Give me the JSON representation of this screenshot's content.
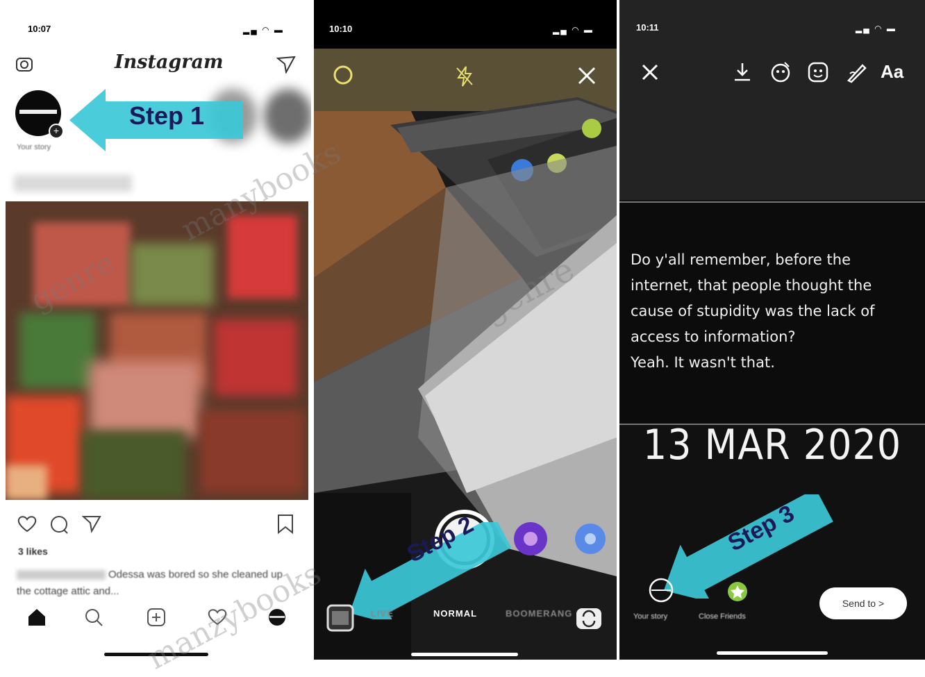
{
  "panel1": {
    "status_time": "10:07",
    "app_title": "Instagram",
    "story_label": "Your story",
    "step_label": "Step 1",
    "likes": "3 likes",
    "caption": "Odessa was bored so she cleaned up the cottage attic and...",
    "icons": [
      "camera-icon",
      "direct-icon",
      "story-plus-icon",
      "heart-icon",
      "comment-icon",
      "share-icon",
      "bookmark-icon",
      "home-icon",
      "search-icon",
      "add-icon",
      "activity-icon",
      "profile-icon"
    ]
  },
  "panel2": {
    "status_time": "10:10",
    "step_label": "Step 2",
    "mode_left": "LIVE",
    "mode_current": "NORMAL",
    "mode_right": "BOOMERANG",
    "icons": [
      "settings-icon",
      "flash-off-icon",
      "close-icon",
      "gallery-icon",
      "flip-camera-icon",
      "shutter-button"
    ]
  },
  "panel3": {
    "status_time": "10:11",
    "text_tool": "Aa",
    "quote": "Do y'all remember, before the internet, that people thought the cause of stupidity was the lack of access to information?\nYeah. It wasn't that.",
    "date_text": "13 MAR 2020",
    "step_label": "Step 3",
    "your_story": "Your story",
    "close_friends": "Close Friends",
    "send_button": "Send to >",
    "icons": [
      "close-icon",
      "download-icon",
      "effects-icon",
      "sticker-icon",
      "draw-icon"
    ]
  },
  "watermark": [
    "genre",
    "manybooks",
    "genre",
    "genre",
    "manzybooks"
  ],
  "colors": {
    "arrow": "#3cc8d8",
    "step_text": "#1a1a5a",
    "panel_dark": "#111111"
  }
}
